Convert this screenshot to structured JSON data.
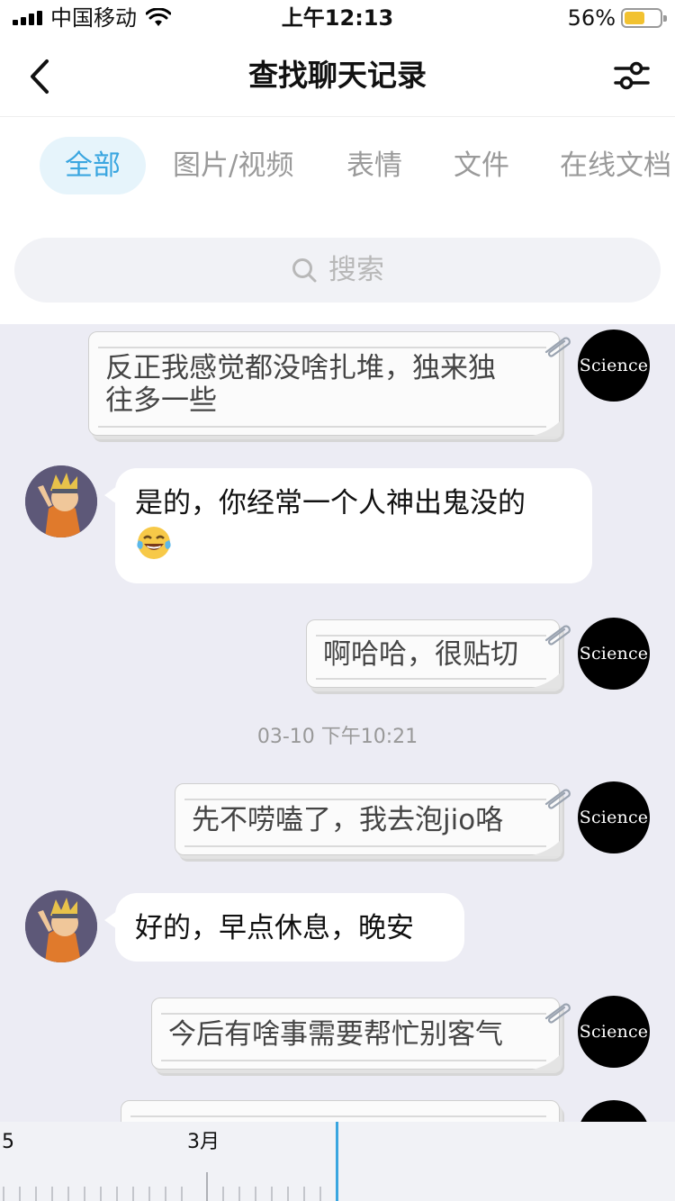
{
  "status_bar": {
    "carrier": "中国移动",
    "time": "上午12:13",
    "battery": "56%"
  },
  "nav": {
    "title": "查找聊天记录"
  },
  "tabs": [
    {
      "label": "全部",
      "active": true
    },
    {
      "label": "图片/视频",
      "active": false
    },
    {
      "label": "表情",
      "active": false
    },
    {
      "label": "文件",
      "active": false
    },
    {
      "label": "在线文档",
      "active": false
    }
  ],
  "search": {
    "placeholder": "搜索"
  },
  "messages": [
    {
      "sender": "self",
      "avatar_text": "Science",
      "lines": [
        "反正我感觉都没啥扎堆，独来独",
        "往多一些"
      ]
    },
    {
      "sender": "other",
      "text": "是的，你经常一个人神出鬼没的",
      "emoji": "tears-of-joy-emoji"
    },
    {
      "sender": "self",
      "avatar_text": "Science",
      "lines": [
        "啊哈哈，很贴切"
      ]
    },
    {
      "sender": "self",
      "avatar_text": "Science",
      "lines": [
        "先不唠嗑了，我去泡jio咯"
      ]
    },
    {
      "sender": "other",
      "text": "好的，早点休息，晚安"
    },
    {
      "sender": "self",
      "avatar_text": "Science",
      "lines": [
        "今后有啥事需要帮忙别客气"
      ]
    }
  ],
  "timestamp": "03-10 下午10:21",
  "timeline": {
    "labels": [
      "5",
      "3月"
    ]
  },
  "colors": {
    "accent": "#3aa6e0",
    "chat_bg": "#ececf4"
  }
}
